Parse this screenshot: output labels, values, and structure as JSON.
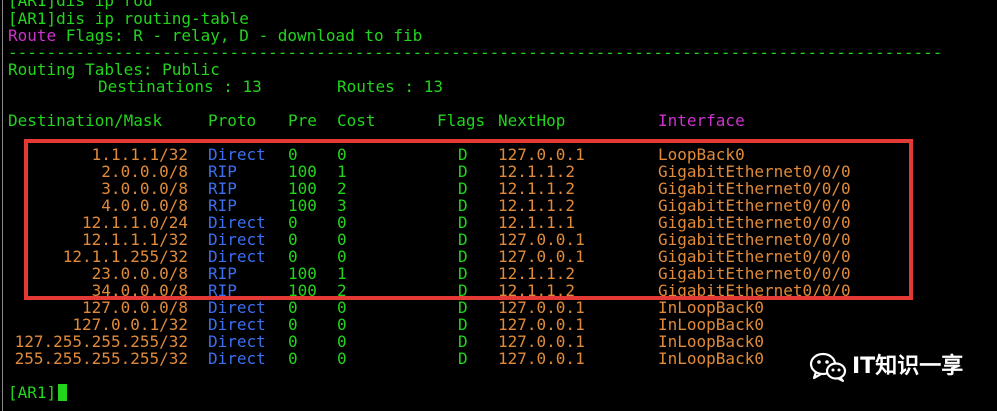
{
  "header": {
    "line_cut": "[AR1]dis ip rou",
    "prompt_line": "[AR1]dis ip routing-table",
    "flags_label": "Route",
    "flags_text": " Flags: R - relay, D - download to fib",
    "separator": "-------------------------------------------------------------------------------------------------",
    "table_title": "Routing Tables: Public",
    "destinations_label": "Destinations : 13",
    "routes_label": "Routes : 13"
  },
  "table": {
    "columns": [
      "Destination/Mask",
      "Proto",
      "Pre",
      "Cost",
      "Flags",
      "NextHop",
      "Interface"
    ],
    "rows": [
      {
        "dest": "1.1.1.1/32",
        "proto": "Direct",
        "pre": "0",
        "cost": "0",
        "flags": "D",
        "nexthop": "127.0.0.1",
        "iface": "LoopBack0"
      },
      {
        "dest": "2.0.0.0/8",
        "proto": "RIP",
        "pre": "100",
        "cost": "1",
        "flags": "D",
        "nexthop": "12.1.1.2",
        "iface": "GigabitEthernet0/0/0"
      },
      {
        "dest": "3.0.0.0/8",
        "proto": "RIP",
        "pre": "100",
        "cost": "2",
        "flags": "D",
        "nexthop": "12.1.1.2",
        "iface": "GigabitEthernet0/0/0"
      },
      {
        "dest": "4.0.0.0/8",
        "proto": "RIP",
        "pre": "100",
        "cost": "3",
        "flags": "D",
        "nexthop": "12.1.1.2",
        "iface": "GigabitEthernet0/0/0"
      },
      {
        "dest": "12.1.1.0/24",
        "proto": "Direct",
        "pre": "0",
        "cost": "0",
        "flags": "D",
        "nexthop": "12.1.1.1",
        "iface": "GigabitEthernet0/0/0"
      },
      {
        "dest": "12.1.1.1/32",
        "proto": "Direct",
        "pre": "0",
        "cost": "0",
        "flags": "D",
        "nexthop": "127.0.0.1",
        "iface": "GigabitEthernet0/0/0"
      },
      {
        "dest": "12.1.1.255/32",
        "proto": "Direct",
        "pre": "0",
        "cost": "0",
        "flags": "D",
        "nexthop": "127.0.0.1",
        "iface": "GigabitEthernet0/0/0"
      },
      {
        "dest": "23.0.0.0/8",
        "proto": "RIP",
        "pre": "100",
        "cost": "1",
        "flags": "D",
        "nexthop": "12.1.1.2",
        "iface": "GigabitEthernet0/0/0"
      },
      {
        "dest": "34.0.0.0/8",
        "proto": "RIP",
        "pre": "100",
        "cost": "2",
        "flags": "D",
        "nexthop": "12.1.1.2",
        "iface": "GigabitEthernet0/0/0"
      },
      {
        "dest": "127.0.0.0/8",
        "proto": "Direct",
        "pre": "0",
        "cost": "0",
        "flags": "D",
        "nexthop": "127.0.0.1",
        "iface": "InLoopBack0"
      },
      {
        "dest": "127.0.0.1/32",
        "proto": "Direct",
        "pre": "0",
        "cost": "0",
        "flags": "D",
        "nexthop": "127.0.0.1",
        "iface": "InLoopBack0"
      },
      {
        "dest": "127.255.255.255/32",
        "proto": "Direct",
        "pre": "0",
        "cost": "0",
        "flags": "D",
        "nexthop": "127.0.0.1",
        "iface": "InLoopBack0"
      },
      {
        "dest": "255.255.255.255/32",
        "proto": "Direct",
        "pre": "0",
        "cost": "0",
        "flags": "D",
        "nexthop": "127.0.0.1",
        "iface": "InLoopBack0"
      }
    ]
  },
  "footer": {
    "prompt": "[AR1]"
  },
  "watermark": {
    "text": "IT知识一享",
    "icon": "wechat-icon"
  },
  "colors": {
    "text": "#22d41c",
    "keyword": "#cc33cc",
    "value": "#e08a3a",
    "proto": "#3b6ff0",
    "highlight": "#e53935",
    "background": "#000000"
  }
}
